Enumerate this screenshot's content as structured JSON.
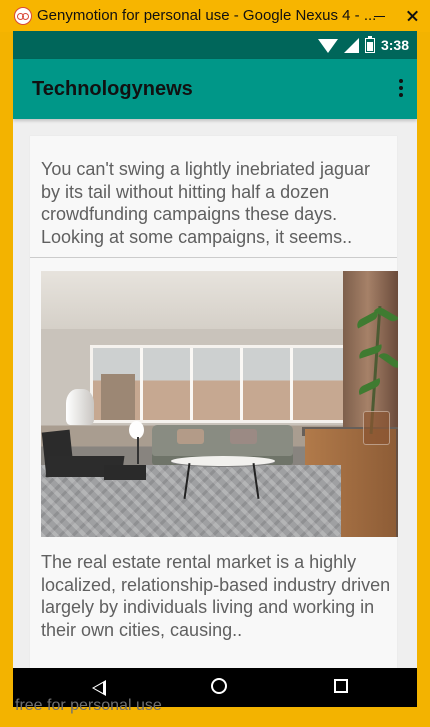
{
  "window": {
    "title": "Genymotion for personal use - Google Nexus 4 - ...",
    "watermark": "free for personal use"
  },
  "status_bar": {
    "time": "3:38",
    "icons": [
      "wifi-icon",
      "signal-icon",
      "battery-icon"
    ]
  },
  "app_bar": {
    "title": "Technologynews",
    "overflow_icon": "overflow-menu-icon"
  },
  "feed": {
    "items": [
      {
        "summary": "You can't swing a lightly inebriated jaguar by its tail without hitting half a dozen crowdfunding campaigns these days. Looking at some campaigns, it seems.."
      },
      {
        "summary": "The real estate rental market is a highly localized, relationship-based industry driven largely by individuals living and working in their own cities, causing.."
      }
    ]
  },
  "navigation": {
    "buttons": [
      "back-icon",
      "home-icon",
      "recents-icon"
    ]
  },
  "colors": {
    "status_bar": "#00665a",
    "app_bar": "#009788",
    "card_background": "#f8f8f8",
    "screen_background": "#efefef",
    "window_frame": "#f3b300"
  }
}
